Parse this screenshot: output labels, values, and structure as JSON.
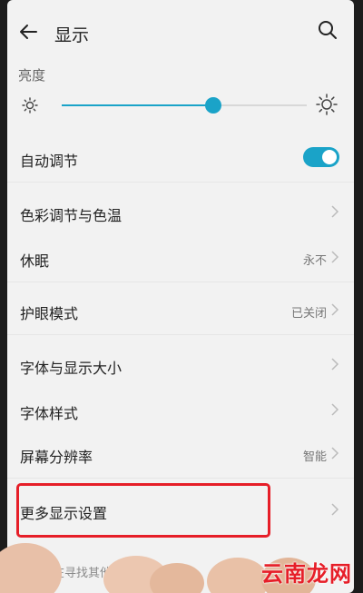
{
  "header": {
    "title": "显示"
  },
  "brightness": {
    "label": "亮度",
    "level_fraction": 0.62
  },
  "rows": [
    {
      "label": "自动调节",
      "type": "toggle",
      "on": true
    },
    {
      "label": "色彩调节与色温",
      "value": ""
    },
    {
      "label": "休眠",
      "value": "永不"
    },
    {
      "label": "护眼模式",
      "value": "已关闭"
    },
    {
      "label": "字体与显示大小",
      "value": ""
    },
    {
      "label": "字体样式",
      "value": ""
    },
    {
      "label": "屏幕分辨率",
      "value": "智能"
    },
    {
      "label": "更多显示设置",
      "value": ""
    }
  ],
  "hint": "是否在寻找其他设置项?",
  "watermark": "云南龙网",
  "colors": {
    "accent": "#1aa3c8",
    "highlight": "#e61e28",
    "background": "#f2f2f2"
  }
}
